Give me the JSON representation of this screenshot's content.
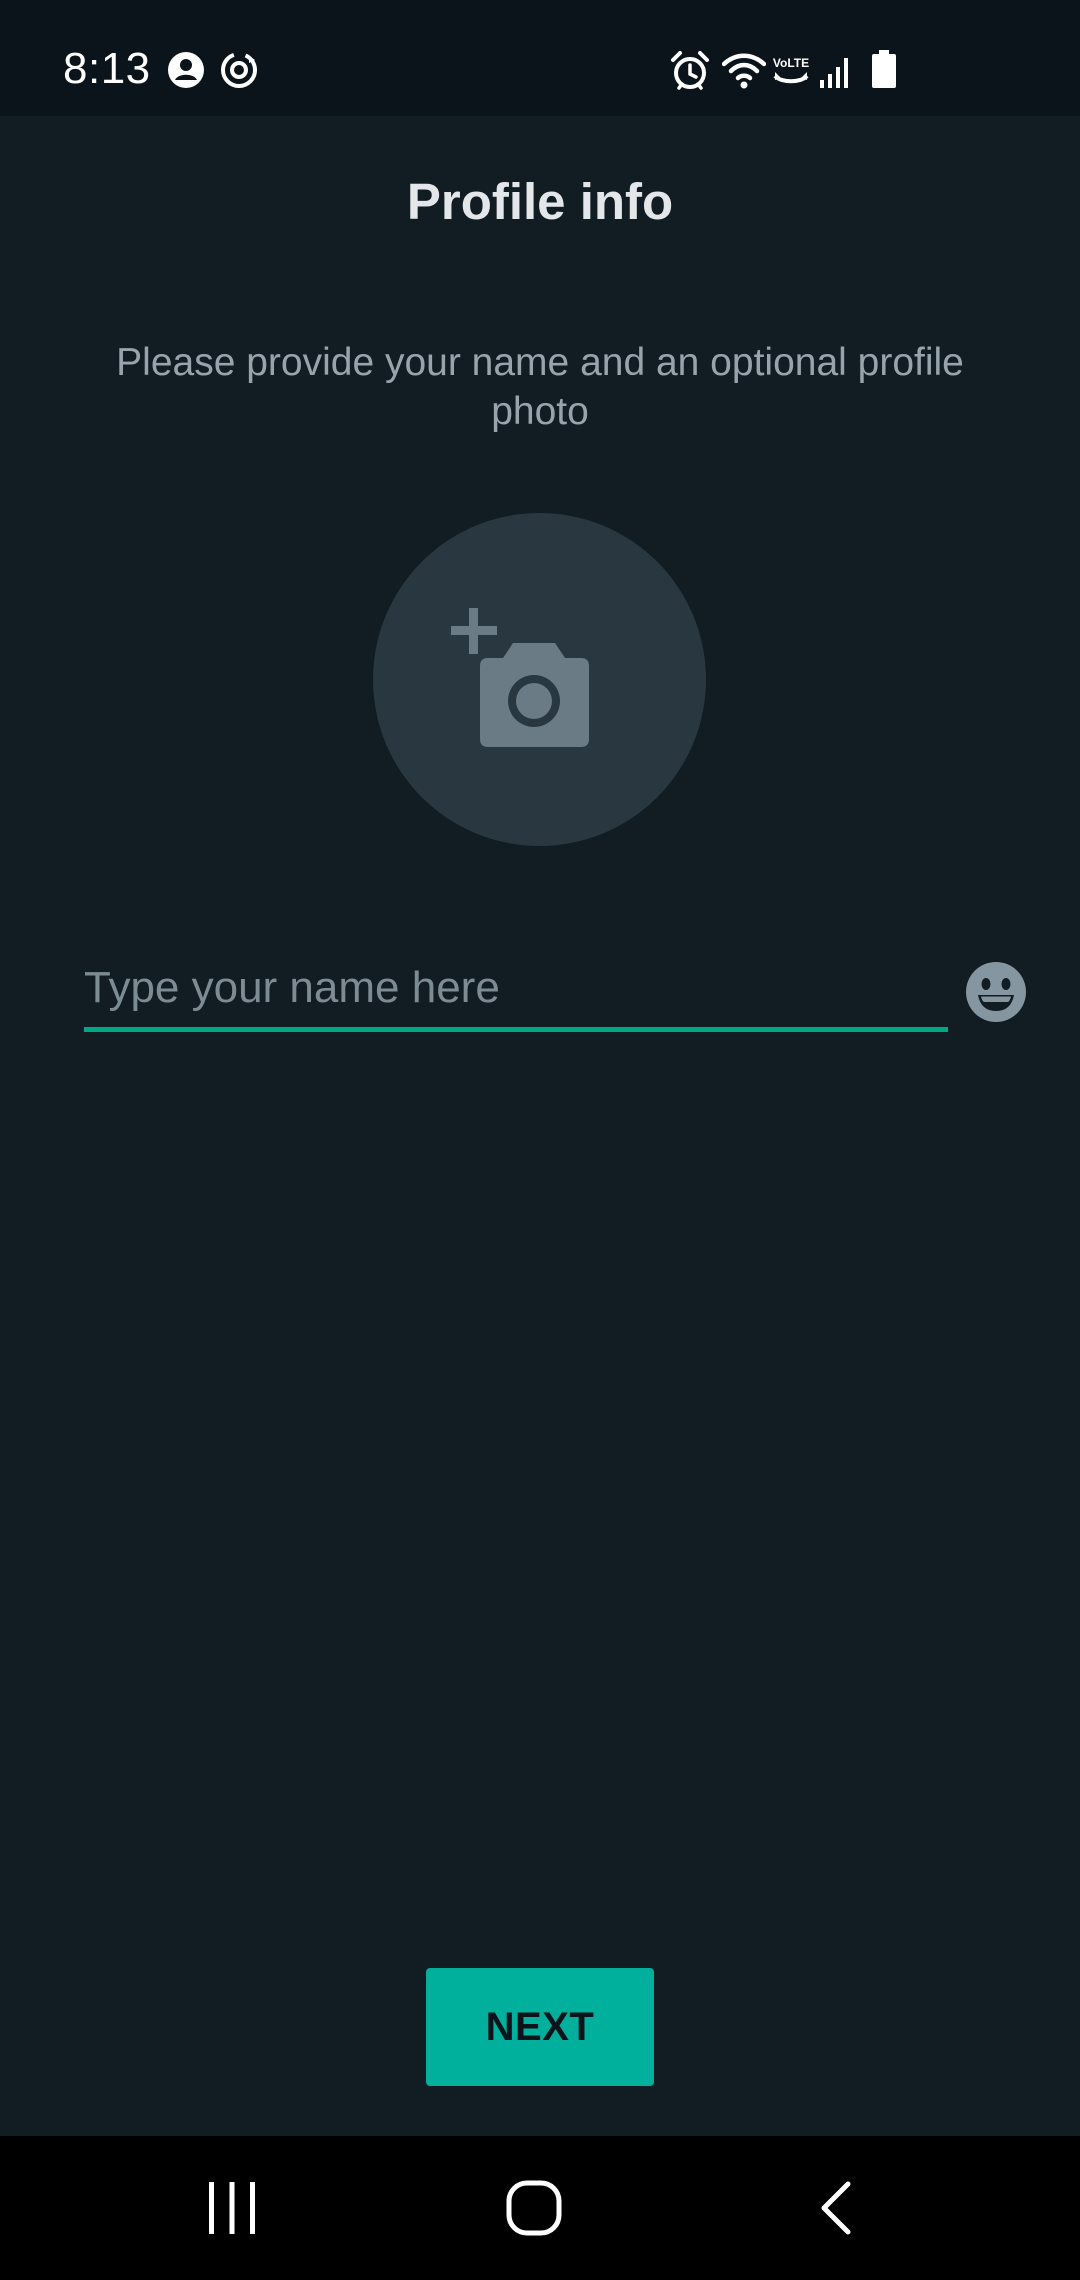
{
  "status_bar": {
    "time": "8:13",
    "left_icons": [
      "account-icon",
      "sync-icon"
    ],
    "right_icons": [
      "alarm-icon",
      "wifi-icon",
      "volte-icon",
      "signal-icon",
      "battery-icon"
    ],
    "volte_label": "VoLTE"
  },
  "header": {
    "title": "Profile info"
  },
  "body": {
    "subtitle": "Please provide your name and an optional profile photo",
    "photo_button_icon": "add-photo-camera-icon",
    "name_input": {
      "value": "",
      "placeholder": "Type your name here"
    },
    "emoji_icon": "emoji-smiley-icon"
  },
  "footer": {
    "next_label": "NEXT"
  },
  "nav_bar": {
    "buttons": [
      "recent-apps-icon",
      "home-icon",
      "back-icon"
    ]
  },
  "colors": {
    "background": "#121c23",
    "status_bar": "#0b141a",
    "accent": "#00a884",
    "button": "#00af9c",
    "photo_circle": "#283740",
    "icon_gray": "#6b7b85"
  }
}
